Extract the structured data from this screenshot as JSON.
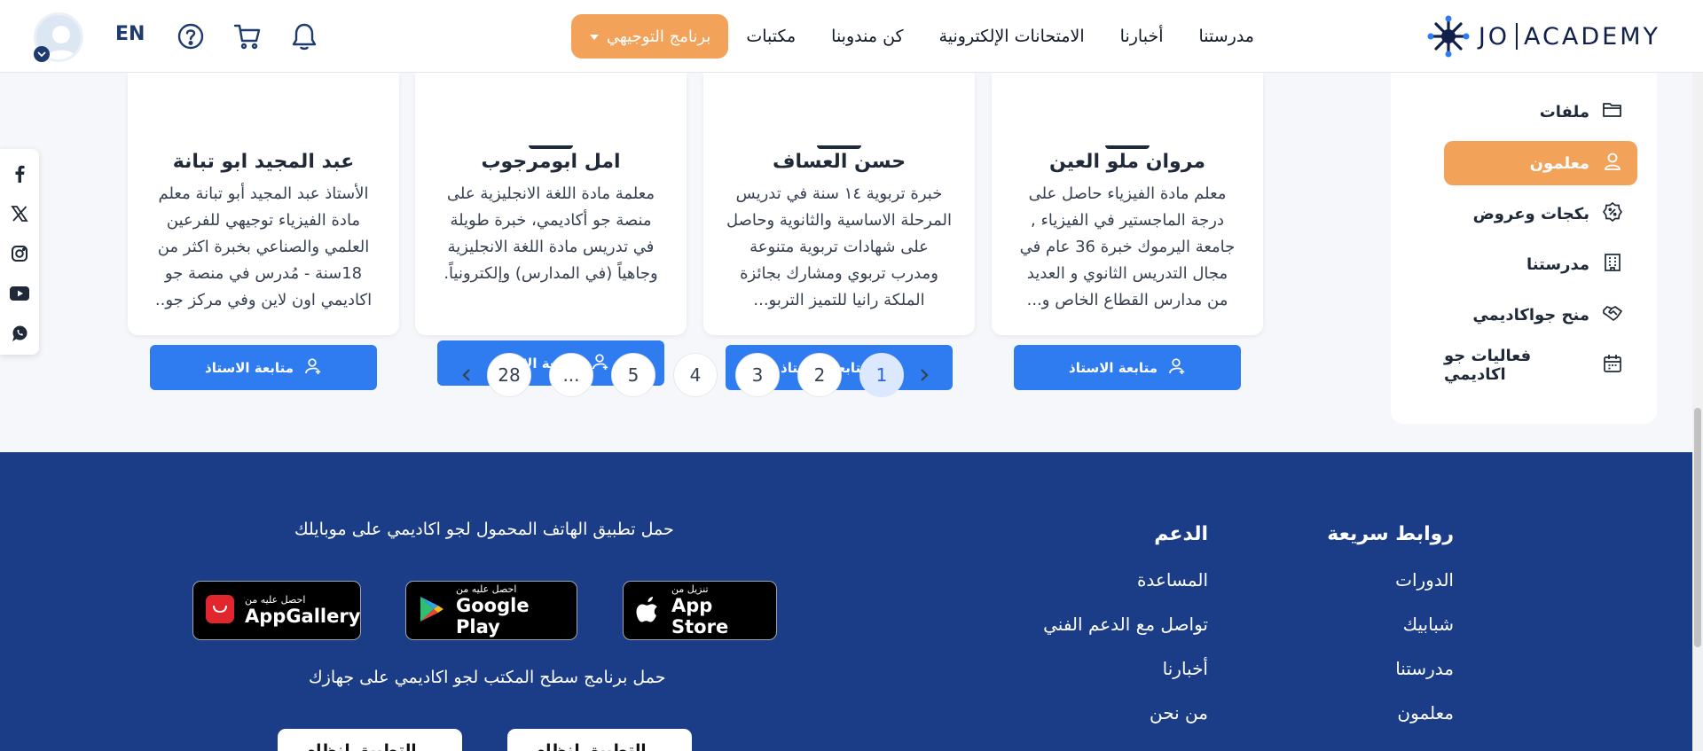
{
  "header": {
    "logo_left": "JO",
    "logo_right": "ACADEMY",
    "nav": [
      "مدرستنا",
      "أخبارنا",
      "الامتحانات الإلكترونية",
      "كن مندوبنا",
      "مكتبات"
    ],
    "program_button": "برنامج التوجيهي",
    "lang": "EN",
    "icons": [
      "bell-icon",
      "cart-icon",
      "help-icon",
      "avatar",
      "chevron-down-icon"
    ]
  },
  "social": [
    "facebook-icon",
    "x-icon",
    "instagram-icon",
    "youtube-icon",
    "whatsapp-icon"
  ],
  "sidebar": {
    "items": [
      {
        "label": "ملفات",
        "icon": "folder-icon"
      },
      {
        "label": "معلمون",
        "icon": "user-icon",
        "active": true
      },
      {
        "label": "بكجات وعروض",
        "icon": "badge-percent-icon"
      },
      {
        "label": "مدرستنا",
        "icon": "building-icon"
      },
      {
        "label": "منح جواكاديمي",
        "icon": "handshake-icon"
      },
      {
        "label": "فعاليات جو اكاديمي",
        "icon": "calendar-icon"
      }
    ]
  },
  "teachers": [
    {
      "name": "مروان ملو العين",
      "bio": "معلم مادة الفيزياء حاصل على درجة الماجستير في الفيزياء , جامعة اليرموك خبرة 36 عام في مجال التدريس الثانوي و العديد من مدارس القطاع الخاص و...",
      "button": "متابعة الاستاذ"
    },
    {
      "name": "حسن العساف",
      "bio": "خبرة تربوية ١٤ سنة في تدريس المرحلة الاساسية والثانوية وحاصل على شهادات تربوية متنوعة ومدرب تربوي ومشارك بجائزة الملكة رانيا للتميز التربو...",
      "button": "متابعة الاستاذ"
    },
    {
      "name": "امل ابومرجوب",
      "bio": "معلمة مادة اللغة الانجليزية على منصة جو أكاديمي، خبرة طويلة في تدريس مادة اللغة الانجليزية وجاهياً (في المدارس) وإلكترونياً.",
      "button": "متابعة الاستاذ"
    },
    {
      "name": "عبد المجيد ابو تبانة",
      "bio": "الأستاذ عبد المجيد أبو تبانة معلم مادة الفيزياء توجيهي للفرعين العلمي والصناعي بخبرة اكثر من 18سنة - مُدرس في منصة جو اكاديمي اون لاين وفي مركز جو..",
      "button": "متابعة الاستاذ"
    }
  ],
  "pagination": {
    "pages": [
      "1",
      "2",
      "3",
      "4",
      "5",
      "...",
      "28"
    ],
    "current": "1"
  },
  "footer": {
    "quick_links_title": "روابط سريعة",
    "quick_links": [
      "الدورات",
      "شبابيك",
      "مدرستنا",
      "معلمون"
    ],
    "support_title": "الدعم",
    "support_links": [
      "المساعدة",
      "تواصل مع الدعم الفني",
      "أخبارنا",
      "من نحن"
    ],
    "mobile_text": "حمل تطبيق الهاتف المحمول لجو اكاديمي على موبايلك",
    "desktop_text": "حمل برنامج سطح المكتب لجو اكاديمي على جهازك",
    "stores": [
      {
        "small": "تنزيل من",
        "big": "App Store",
        "icon": "apple-icon"
      },
      {
        "small": "احصل عليه من",
        "big": "Google Play",
        "icon": "google-play-icon"
      },
      {
        "small": "احصل عليه من",
        "big": "AppGallery",
        "icon": "huawei-icon"
      }
    ],
    "desktop_buttons": [
      "التطبيق لنظام",
      "التطبيق لنظام"
    ]
  },
  "colors": {
    "primary": "#2f7bf0",
    "accent": "#f3a25a",
    "footer": "#1b3d87",
    "navy": "#10204a"
  }
}
